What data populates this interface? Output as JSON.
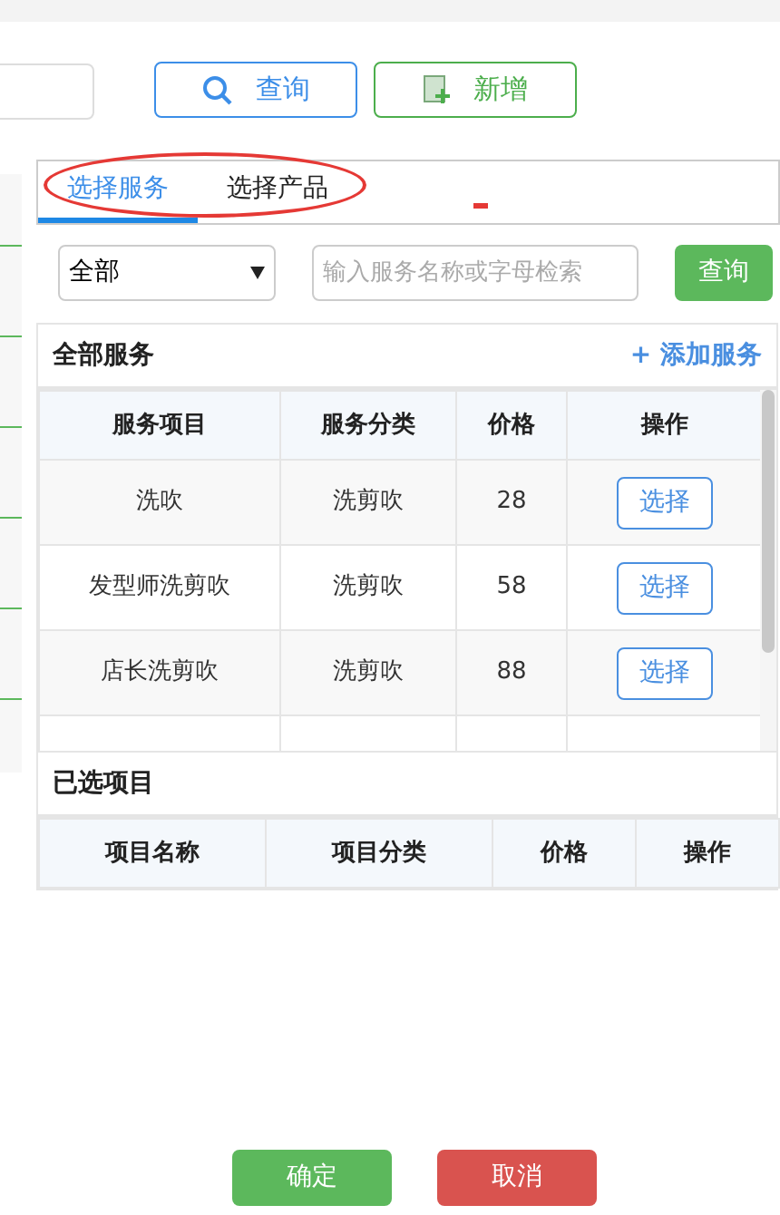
{
  "toolbar": {
    "buttons": [
      {
        "kind": "search",
        "label": "查询"
      },
      {
        "kind": "add",
        "label": "新增"
      }
    ]
  },
  "tabs": [
    {
      "label": "选择服务",
      "selected": true
    },
    {
      "label": "选择产品",
      "selected": false
    }
  ],
  "filter": {
    "category": "全部",
    "search_placeholder": "输入服务名称或字母检索",
    "button": "查询"
  },
  "services": {
    "title": "全部服务",
    "add_link": "+ 添加服务",
    "columns": [
      "服务项目",
      "服务分类",
      "价格",
      "操作"
    ],
    "rows": [
      {
        "name": "洗吹",
        "category": "洗剪吹",
        "price": "28",
        "action": "选择"
      },
      {
        "name": "发型师洗剪吹",
        "category": "洗剪吹",
        "price": "58",
        "action": "选择"
      },
      {
        "name": "店长洗剪吹",
        "category": "洗剪吹",
        "price": "88",
        "action": "选择"
      }
    ]
  },
  "selected": {
    "title": "已选项目",
    "columns": [
      "项目名称",
      "项目分类",
      "价格",
      "操作"
    ]
  },
  "footer": {
    "confirm": "确定",
    "cancel": "取消"
  }
}
